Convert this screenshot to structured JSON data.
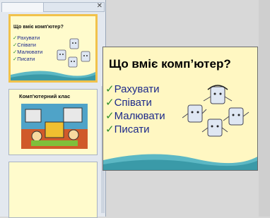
{
  "slides_panel": {
    "slide1": {
      "title": "Що вміє комп'ютер?",
      "items": [
        "Рахувати",
        "Співати",
        "Малювати",
        "Писати"
      ]
    },
    "slide2": {
      "title": "Комп'ютерний клас"
    },
    "close_glyph": "✕"
  },
  "main_slide": {
    "title": "Що вміє комп’ютер?",
    "items": [
      "Рахувати",
      "Співати",
      "Малювати",
      "Писати"
    ],
    "check_glyph": "✓"
  },
  "colors": {
    "slide_bg": "#fffbcc",
    "selected_border": "#f1c24b",
    "wave": "#5cb8c4",
    "item_text": "#1d2a8a"
  }
}
